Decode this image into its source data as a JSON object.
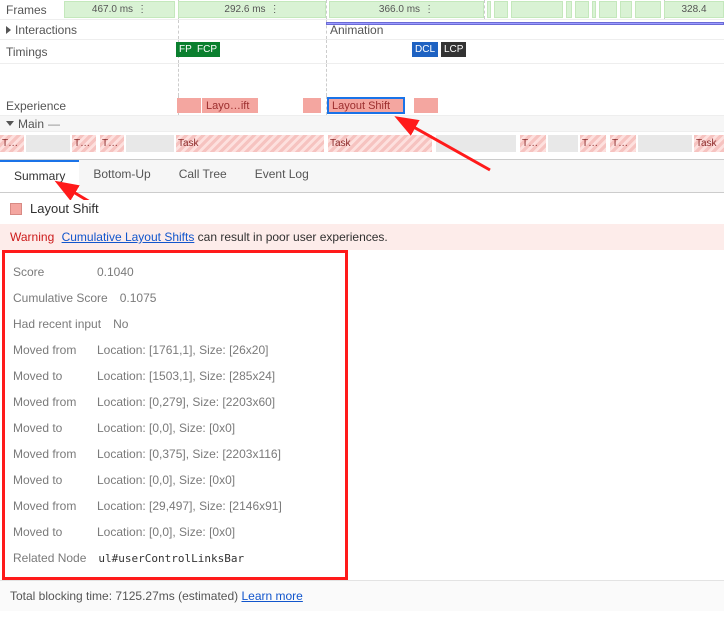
{
  "timeline": {
    "rows": {
      "frames": "Frames",
      "interactions": "Interactions",
      "timings": "Timings",
      "experience": "Experience",
      "main": "Main"
    },
    "frame_times": [
      "467.0 ms",
      "292.6 ms",
      "366.0 ms",
      "328.4"
    ],
    "interactions_label": "Animation",
    "timings": {
      "fp": "FP",
      "fcp": "FCP",
      "dcl": "DCL",
      "lcp": "LCP"
    },
    "experience": {
      "block1": "Layo…ift",
      "block2": "Layout Shift"
    },
    "task_labels": [
      "T…",
      "T…",
      "T…",
      "Task",
      "Task",
      "T…",
      "T…",
      "T…",
      "Task"
    ]
  },
  "tabs": {
    "summary": "Summary",
    "bottom_up": "Bottom-Up",
    "call_tree": "Call Tree",
    "event_log": "Event Log"
  },
  "summary": {
    "section_title": "Layout Shift",
    "warning_label": "Warning",
    "warning_link": "Cumulative Layout Shifts",
    "warning_tail": " can result in poor user experiences.",
    "rows": [
      {
        "k": "Score",
        "v": "0.1040"
      },
      {
        "k": "Cumulative Score",
        "v": "0.1075"
      },
      {
        "k": "Had recent input",
        "v": "No"
      },
      {
        "k": "Moved from",
        "v": "Location: [1761,1], Size: [26x20]"
      },
      {
        "k": "Moved to",
        "v": "Location: [1503,1], Size: [285x24]"
      },
      {
        "k": "Moved from",
        "v": "Location: [0,279], Size: [2203x60]"
      },
      {
        "k": "Moved to",
        "v": "Location: [0,0], Size: [0x0]"
      },
      {
        "k": "Moved from",
        "v": "Location: [0,375], Size: [2203x116]"
      },
      {
        "k": "Moved to",
        "v": "Location: [0,0], Size: [0x0]"
      },
      {
        "k": "Moved from",
        "v": "Location: [29,497], Size: [2146x91]"
      },
      {
        "k": "Moved to",
        "v": "Location: [0,0], Size: [0x0]"
      },
      {
        "k": "Related Node",
        "mono": "ul#userControlLinksBar"
      }
    ]
  },
  "footer": {
    "text_prefix": "Total blocking time: ",
    "value": "7125.27ms (estimated)",
    "learn_more": "Learn more"
  }
}
